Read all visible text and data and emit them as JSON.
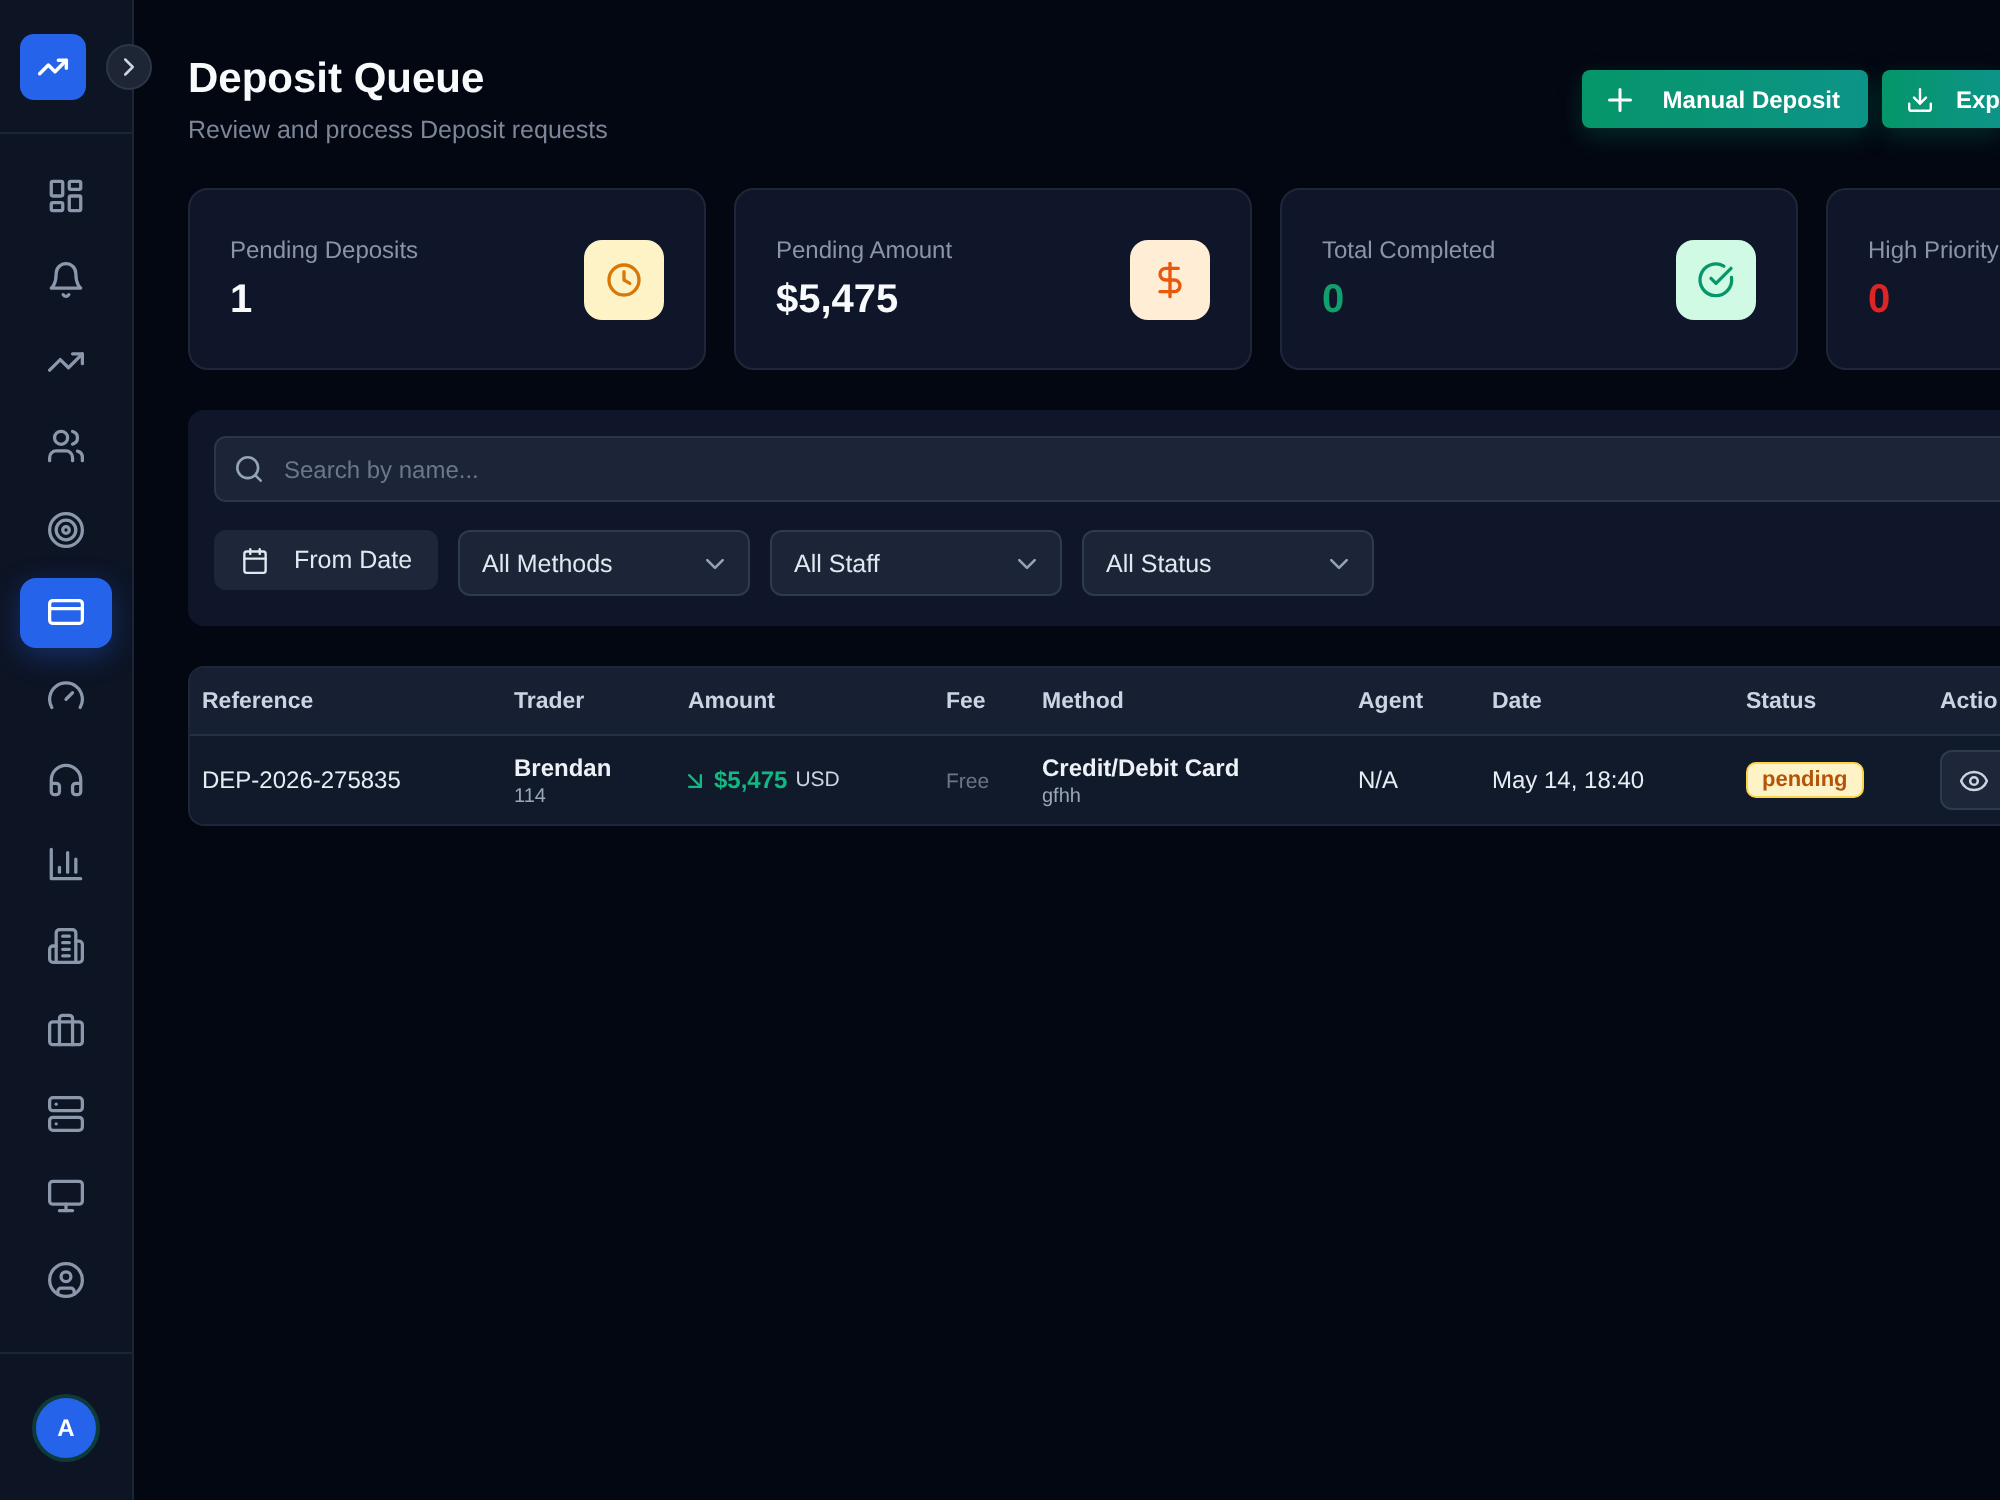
{
  "sidebar": {
    "items": [
      {
        "selected": false
      },
      {
        "selected": false
      },
      {
        "selected": false
      },
      {
        "selected": false
      },
      {
        "selected": false
      },
      {
        "selected": true
      },
      {
        "selected": false
      },
      {
        "selected": false
      },
      {
        "selected": false
      },
      {
        "selected": false
      },
      {
        "selected": false
      },
      {
        "selected": false
      },
      {
        "selected": false
      },
      {
        "selected": false
      }
    ],
    "avatar": "A"
  },
  "header": {
    "title": "Deposit Queue",
    "subtitle": "Review and process Deposit requests",
    "actions": [
      {
        "label": "Manual Deposit",
        "kind": "add"
      },
      {
        "label": "Exp",
        "kind": "download"
      }
    ]
  },
  "stats": [
    {
      "label": "Pending Deposits",
      "value": "1",
      "kind": "pending"
    },
    {
      "label": "Pending Amount",
      "value": "$5,475",
      "kind": "amount"
    },
    {
      "label": "Total Completed",
      "value": "0",
      "kind": "completed"
    },
    {
      "label": "High Priority",
      "value": "0",
      "kind": "priority"
    }
  ],
  "filters": {
    "search": {
      "placeholder": "Search by name..."
    },
    "date": {
      "label": "From Date"
    },
    "dropdowns": [
      {
        "value": "All Methods"
      },
      {
        "value": "All Staff"
      },
      {
        "value": "All Status"
      }
    ]
  },
  "table": {
    "columns": [
      "Reference",
      "Trader",
      "Amount",
      "Fee",
      "Method",
      "Agent",
      "Date",
      "Status",
      "Actio"
    ],
    "rows": [
      {
        "reference": "DEP-2026-275835",
        "trader": {
          "name": "Brendan",
          "number": "114"
        },
        "amount": {
          "value": "$5,475",
          "currency": "USD"
        },
        "fee": "Free",
        "method": {
          "name": "Credit/Debit Card",
          "detail": "gfhh"
        },
        "agent": "N/A",
        "date": "May 14, 18:40",
        "status": {
          "label": "pending",
          "kind": "pending"
        }
      }
    ]
  }
}
